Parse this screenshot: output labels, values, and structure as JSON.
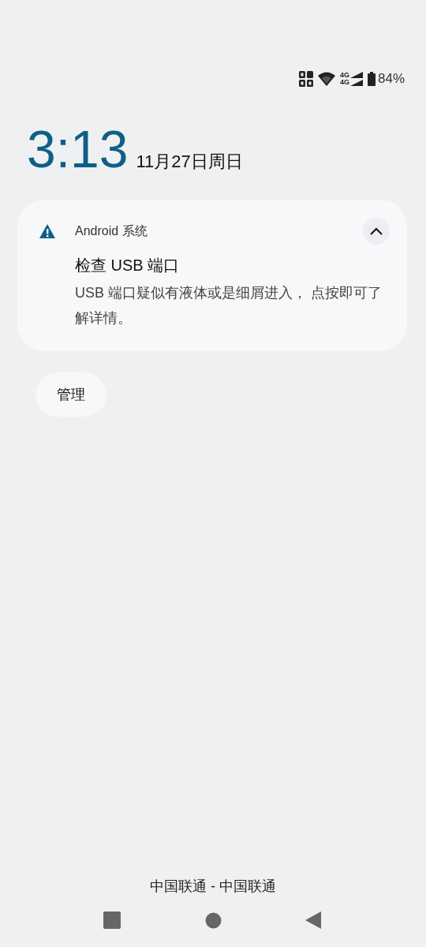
{
  "status_bar": {
    "battery_text": "84%",
    "network_1": "4G",
    "network_2": "4G"
  },
  "lockscreen": {
    "time": "3:13",
    "date": "11月27日周日"
  },
  "notification": {
    "app": "Android 系统",
    "title": "检查 USB 端口",
    "body": "USB 端口疑似有液体或是细屑进入， 点按即可了解详情。",
    "expanded": true
  },
  "actions": [
    "管理"
  ],
  "carrier": "中国联通 - 中国联通"
}
